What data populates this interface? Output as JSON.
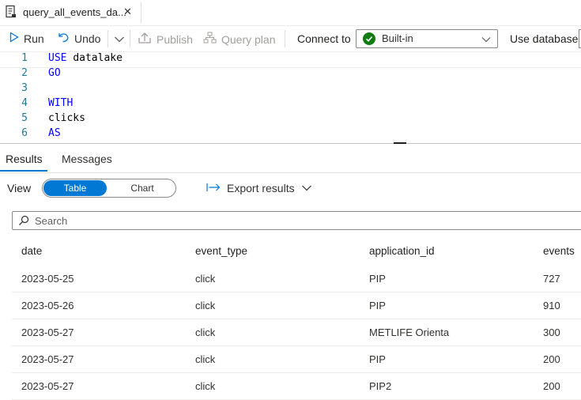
{
  "tab": {
    "title": "query_all_events_da...",
    "close": "✕"
  },
  "toolbar": {
    "run": "Run",
    "undo": "Undo",
    "publish": "Publish",
    "query_plan": "Query plan",
    "connect_to": "Connect to",
    "connect_value": "Built-in",
    "use_database": "Use database"
  },
  "editor": {
    "lines": [
      {
        "num": "1",
        "text": "USE datalake"
      },
      {
        "num": "2",
        "text": "GO"
      },
      {
        "num": "3",
        "text": ""
      },
      {
        "num": "4",
        "text": "WITH"
      },
      {
        "num": "5",
        "text": "clicks"
      },
      {
        "num": "6",
        "text": "AS"
      }
    ]
  },
  "results": {
    "tabs": [
      "Results",
      "Messages"
    ],
    "view_label": "View",
    "view_options": [
      "Table",
      "Chart"
    ],
    "export": "Export results",
    "search_placeholder": "Search",
    "columns": [
      "date",
      "event_type",
      "application_id",
      "events"
    ],
    "rows": [
      [
        "2023-05-25",
        "click",
        "PIP",
        "727"
      ],
      [
        "2023-05-26",
        "click",
        "PIP",
        "910"
      ],
      [
        "2023-05-27",
        "click",
        "METLIFE Orienta",
        "300"
      ],
      [
        "2023-05-27",
        "click",
        "PIP",
        "200"
      ],
      [
        "2023-05-27",
        "click",
        "PIP2",
        "200"
      ]
    ]
  },
  "colors": {
    "accent": "#0078d4",
    "success": "#107c10",
    "keyword": "#0000ff",
    "line_number": "#237893"
  },
  "icons": [
    "query-file-icon",
    "close-icon",
    "run-icon",
    "undo-icon",
    "chevron-down-icon",
    "publish-icon",
    "query-plan-icon",
    "check-circle-icon",
    "export-arrow-icon",
    "search-icon"
  ]
}
